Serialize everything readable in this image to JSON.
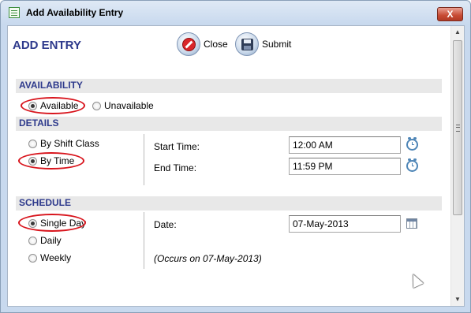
{
  "window": {
    "title": "Add Availability Entry",
    "close_glyph": "X"
  },
  "header": {
    "title": "ADD ENTRY"
  },
  "toolbar": {
    "close_label": "Close",
    "submit_label": "Submit"
  },
  "sections": {
    "availability": "AVAILABILITY",
    "details": "DETAILS",
    "schedule": "SCHEDULE"
  },
  "availability": {
    "available": "Available",
    "unavailable": "Unavailable",
    "selected": "Available"
  },
  "details": {
    "by_shift_class": "By Shift Class",
    "by_time": "By Time",
    "selected": "By Time",
    "start_time_label": "Start Time:",
    "start_time_value": "12:00 AM",
    "end_time_label": "End Time:",
    "end_time_value": "11:59 PM"
  },
  "schedule": {
    "single_day": "Single Day",
    "daily": "Daily",
    "weekly": "Weekly",
    "selected": "Single Day",
    "date_label": "Date:",
    "date_value": "07-May-2013",
    "occurs_note": "(Occurs on 07-May-2013)"
  },
  "colors": {
    "accent": "#2e3a8c",
    "highlight_ring": "#d8141c",
    "section_bg": "#e8e8e8"
  },
  "icons": [
    "list-icon",
    "window-close-icon",
    "close-icon",
    "save-icon",
    "clock-icon",
    "calendar-icon",
    "cursor-icon"
  ]
}
